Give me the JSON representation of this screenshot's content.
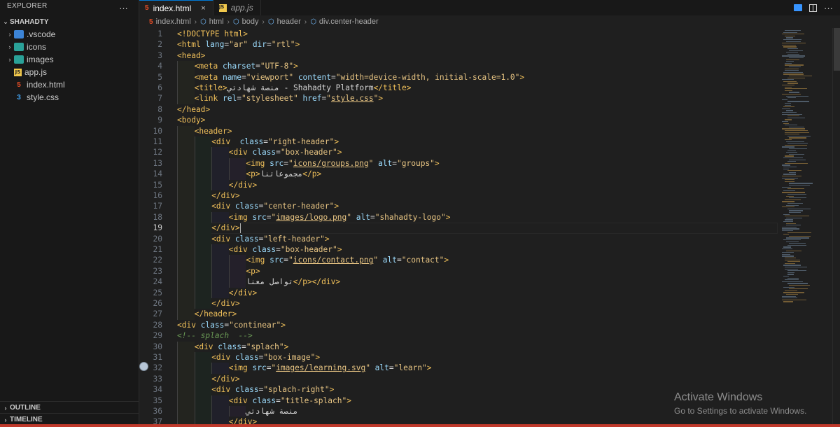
{
  "sidebar": {
    "header": "EXPLORER",
    "more_icon": "…",
    "folder": "SHAHADTY",
    "items": [
      {
        "label": ".vscode",
        "type": "folder",
        "icon": "folder-vscode-icon"
      },
      {
        "label": "icons",
        "type": "folder",
        "icon": "folder-icon"
      },
      {
        "label": "images",
        "type": "folder",
        "icon": "folder-images-icon"
      },
      {
        "label": "app.js",
        "type": "file",
        "icon": "js-file-icon"
      },
      {
        "label": "index.html",
        "type": "file",
        "icon": "html-file-icon"
      },
      {
        "label": "style.css",
        "type": "file",
        "icon": "css-file-icon"
      }
    ],
    "outline": "OUTLINE",
    "timeline": "TIMELINE"
  },
  "tabs": [
    {
      "label": "index.html",
      "icon": "html-file-icon",
      "active": true,
      "close": "×"
    },
    {
      "label": "app.js",
      "icon": "js-file-icon",
      "active": false
    }
  ],
  "breadcrumb": [
    "index.html",
    "html",
    "body",
    "header",
    "div.center-header"
  ],
  "editor": {
    "current_line": 19,
    "lines": [
      {
        "n": "1",
        "indent": 0,
        "segs": [
          [
            "t-tag",
            "<!DOCTYPE html>"
          ]
        ]
      },
      {
        "n": "2",
        "indent": 0,
        "segs": [
          [
            "t-tag",
            "<html "
          ],
          [
            "t-attr",
            "lang"
          ],
          [
            "t-eq",
            "="
          ],
          [
            "t-str-y",
            "\"ar\""
          ],
          [
            "t-attr",
            " dir"
          ],
          [
            "t-eq",
            "="
          ],
          [
            "t-str-y",
            "\"rtl\""
          ],
          [
            "t-tag",
            ">"
          ]
        ]
      },
      {
        "n": "3",
        "indent": 0,
        "segs": [
          [
            "t-tag",
            "<head>"
          ]
        ]
      },
      {
        "n": "4",
        "indent": 1,
        "segs": [
          [
            "t-tag",
            "<meta "
          ],
          [
            "t-attr",
            "charset"
          ],
          [
            "t-eq",
            "="
          ],
          [
            "t-str-y",
            "\"UTF-8\""
          ],
          [
            "t-tag",
            ">"
          ]
        ]
      },
      {
        "n": "5",
        "indent": 1,
        "segs": [
          [
            "t-tag",
            "<meta "
          ],
          [
            "t-attr",
            "name"
          ],
          [
            "t-eq",
            "="
          ],
          [
            "t-str-y",
            "\"viewport\""
          ],
          [
            "t-attr",
            " content"
          ],
          [
            "t-eq",
            "="
          ],
          [
            "t-str-y",
            "\"width=device-width, initial-scale=1.0\""
          ],
          [
            "t-tag",
            ">"
          ]
        ]
      },
      {
        "n": "6",
        "indent": 1,
        "segs": [
          [
            "t-tag",
            "<title>"
          ],
          [
            "t-txt",
            "منصة شهادتي - Shahadty Platform"
          ],
          [
            "t-tag",
            "</title>"
          ]
        ]
      },
      {
        "n": "7",
        "indent": 1,
        "segs": [
          [
            "t-tag",
            "<link "
          ],
          [
            "t-attr",
            "rel"
          ],
          [
            "t-eq",
            "="
          ],
          [
            "t-str-y",
            "\"stylesheet\""
          ],
          [
            "t-attr",
            " href"
          ],
          [
            "t-eq",
            "="
          ],
          [
            "t-str-y",
            "\""
          ],
          [
            "t-str-y t-link",
            "style.css"
          ],
          [
            "t-str-y",
            "\""
          ],
          [
            "t-tag",
            ">"
          ]
        ]
      },
      {
        "n": "8",
        "indent": 0,
        "segs": [
          [
            "t-tag",
            "</head>"
          ]
        ]
      },
      {
        "n": "9",
        "indent": 0,
        "segs": [
          [
            "t-tag",
            "<body>"
          ]
        ]
      },
      {
        "n": "10",
        "indent": 1,
        "segs": [
          [
            "t-tag",
            "<header>"
          ]
        ]
      },
      {
        "n": "11",
        "indent": 2,
        "segs": [
          [
            "t-tag",
            "<div  "
          ],
          [
            "t-attr",
            "class"
          ],
          [
            "t-eq",
            "="
          ],
          [
            "t-str-y",
            "\"right-header\""
          ],
          [
            "t-tag",
            ">"
          ]
        ]
      },
      {
        "n": "12",
        "indent": 3,
        "segs": [
          [
            "t-tag",
            "<div "
          ],
          [
            "t-attr",
            "class"
          ],
          [
            "t-eq",
            "="
          ],
          [
            "t-str-y",
            "\"box-header\""
          ],
          [
            "t-tag",
            ">"
          ]
        ]
      },
      {
        "n": "13",
        "indent": 4,
        "segs": [
          [
            "t-tag",
            "<img "
          ],
          [
            "t-attr",
            "src"
          ],
          [
            "t-eq",
            "="
          ],
          [
            "t-str-y",
            "\""
          ],
          [
            "t-str-y t-link",
            "icons/groups.png"
          ],
          [
            "t-str-y",
            "\""
          ],
          [
            "t-attr",
            " alt"
          ],
          [
            "t-eq",
            "="
          ],
          [
            "t-str-y",
            "\"groups\""
          ],
          [
            "t-tag",
            ">"
          ]
        ]
      },
      {
        "n": "14",
        "indent": 4,
        "segs": [
          [
            "t-tag",
            "<p>"
          ],
          [
            "t-txt",
            "مجموعاتنا"
          ],
          [
            "t-tag",
            "</p>"
          ]
        ]
      },
      {
        "n": "15",
        "indent": 3,
        "segs": [
          [
            "t-tag",
            "</div>"
          ]
        ]
      },
      {
        "n": "16",
        "indent": 2,
        "segs": [
          [
            "t-tag",
            "</div>"
          ]
        ]
      },
      {
        "n": "17",
        "indent": 2,
        "segs": [
          [
            "t-tag",
            "<div "
          ],
          [
            "t-attr",
            "class"
          ],
          [
            "t-eq",
            "="
          ],
          [
            "t-str-y",
            "\"center-header\""
          ],
          [
            "t-tag",
            ">"
          ]
        ]
      },
      {
        "n": "18",
        "indent": 3,
        "segs": [
          [
            "t-tag",
            "<img "
          ],
          [
            "t-attr",
            "src"
          ],
          [
            "t-eq",
            "="
          ],
          [
            "t-str-y",
            "\""
          ],
          [
            "t-str-y t-link",
            "images/logo.png"
          ],
          [
            "t-str-y",
            "\""
          ],
          [
            "t-attr",
            " alt"
          ],
          [
            "t-eq",
            "="
          ],
          [
            "t-str-y",
            "\"shahadty-logo\""
          ],
          [
            "t-tag",
            ">"
          ]
        ]
      },
      {
        "n": "19",
        "indent": 2,
        "segs": [
          [
            "t-tag",
            "</div>"
          ]
        ]
      },
      {
        "n": "20",
        "indent": 2,
        "segs": [
          [
            "t-tag",
            "<div "
          ],
          [
            "t-attr",
            "class"
          ],
          [
            "t-eq",
            "="
          ],
          [
            "t-str-y",
            "\"left-header\""
          ],
          [
            "t-tag",
            ">"
          ]
        ]
      },
      {
        "n": "21",
        "indent": 3,
        "segs": [
          [
            "t-tag",
            "<div "
          ],
          [
            "t-attr",
            "class"
          ],
          [
            "t-eq",
            "="
          ],
          [
            "t-str-y",
            "\"box-header\""
          ],
          [
            "t-tag",
            ">"
          ]
        ]
      },
      {
        "n": "22",
        "indent": 4,
        "segs": [
          [
            "t-tag",
            "<img "
          ],
          [
            "t-attr",
            "src"
          ],
          [
            "t-eq",
            "="
          ],
          [
            "t-str-y",
            "\""
          ],
          [
            "t-str-y t-link",
            "icons/contact.png"
          ],
          [
            "t-str-y",
            "\""
          ],
          [
            "t-attr",
            " alt"
          ],
          [
            "t-eq",
            "="
          ],
          [
            "t-str-y",
            "\"contact\""
          ],
          [
            "t-tag",
            ">"
          ]
        ]
      },
      {
        "n": "23",
        "indent": 4,
        "segs": [
          [
            "t-tag",
            "<p>"
          ]
        ]
      },
      {
        "n": "24",
        "indent": 4,
        "segs": [
          [
            "t-txt",
            "تواصل معنا"
          ],
          [
            "t-tag",
            "</p></div>"
          ]
        ]
      },
      {
        "n": "25",
        "indent": 3,
        "segs": [
          [
            "t-tag",
            "</div>"
          ]
        ]
      },
      {
        "n": "26",
        "indent": 2,
        "segs": [
          [
            "t-tag",
            "</div>"
          ]
        ]
      },
      {
        "n": "27",
        "indent": 1,
        "segs": [
          [
            "t-tag",
            "</header>"
          ]
        ]
      },
      {
        "n": "28",
        "indent": 0,
        "segs": [
          [
            "t-tag",
            "<div "
          ],
          [
            "t-attr",
            "class"
          ],
          [
            "t-eq",
            "="
          ],
          [
            "t-str-y",
            "\"continear\""
          ],
          [
            "t-tag",
            ">"
          ]
        ]
      },
      {
        "n": "29",
        "indent": 0,
        "segs": [
          [
            "t-com",
            "<!-- splach  -->"
          ]
        ]
      },
      {
        "n": "30",
        "indent": 1,
        "segs": [
          [
            "t-tag",
            "<div "
          ],
          [
            "t-attr",
            "class"
          ],
          [
            "t-eq",
            "="
          ],
          [
            "t-str-y",
            "\"splach\""
          ],
          [
            "t-tag",
            ">"
          ]
        ]
      },
      {
        "n": "31",
        "indent": 2,
        "segs": [
          [
            "t-tag",
            "<div "
          ],
          [
            "t-attr",
            "class"
          ],
          [
            "t-eq",
            "="
          ],
          [
            "t-str-y",
            "\"box-image\""
          ],
          [
            "t-tag",
            ">"
          ]
        ]
      },
      {
        "n": "32",
        "indent": 3,
        "segs": [
          [
            "t-tag",
            "<img "
          ],
          [
            "t-attr",
            "src"
          ],
          [
            "t-eq",
            "="
          ],
          [
            "t-str-y",
            "\""
          ],
          [
            "t-str-y t-link",
            "images/learning.svg"
          ],
          [
            "t-str-y",
            "\""
          ],
          [
            "t-attr",
            " alt"
          ],
          [
            "t-eq",
            "="
          ],
          [
            "t-str-y",
            "\"learn\""
          ],
          [
            "t-tag",
            ">"
          ]
        ]
      },
      {
        "n": "33",
        "indent": 2,
        "segs": [
          [
            "t-tag",
            "</div>"
          ]
        ]
      },
      {
        "n": "34",
        "indent": 2,
        "segs": [
          [
            "t-tag",
            "<div "
          ],
          [
            "t-attr",
            "class"
          ],
          [
            "t-eq",
            "="
          ],
          [
            "t-str-y",
            "\"splach-right\""
          ],
          [
            "t-tag",
            ">"
          ]
        ]
      },
      {
        "n": "35",
        "indent": 3,
        "segs": [
          [
            "t-tag",
            "<div "
          ],
          [
            "t-attr",
            "class"
          ],
          [
            "t-eq",
            "="
          ],
          [
            "t-str-y",
            "\"title-splach\""
          ],
          [
            "t-tag",
            ">"
          ]
        ]
      },
      {
        "n": "36",
        "indent": 4,
        "segs": [
          [
            "t-txt",
            "منصة شهادتي"
          ]
        ]
      },
      {
        "n": "37",
        "indent": 3,
        "segs": [
          [
            "t-tag",
            "</div>"
          ]
        ]
      }
    ]
  },
  "watermark": {
    "title": "Activate Windows",
    "subtitle": "Go to Settings to activate Windows."
  },
  "colors": {
    "accent": "#0078d4",
    "tag": "#f0c05a",
    "attr": "#9cdcfe",
    "string": "#e8c583",
    "comment": "#6a9955"
  }
}
